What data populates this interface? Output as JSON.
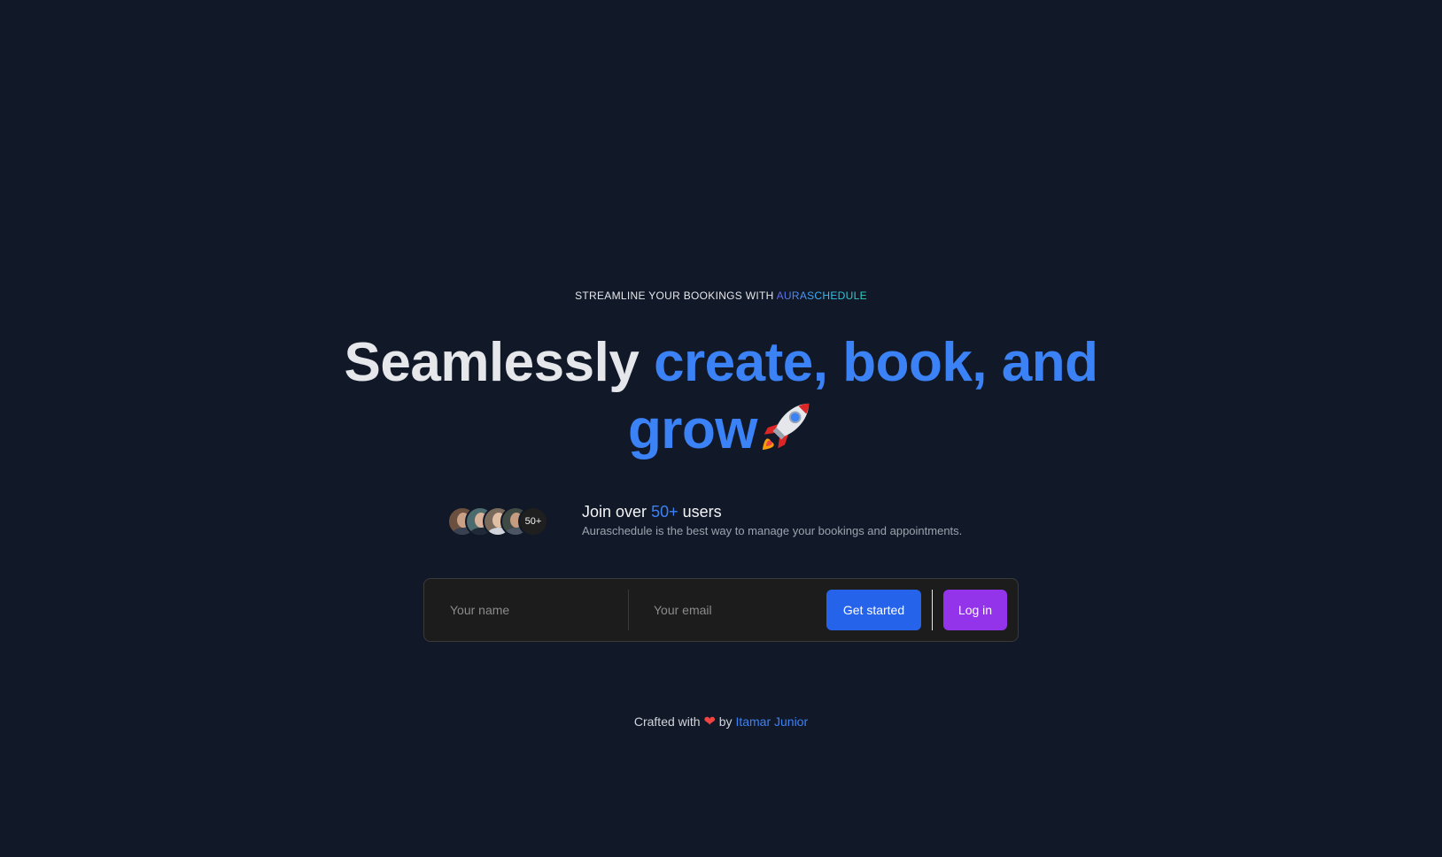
{
  "hero": {
    "eyebrow_prefix": "STREAMLINE YOUR BOOKINGS WITH",
    "eyebrow_brand": "AURASCHEDULE",
    "headline_plain": "Seamlessly",
    "headline_accent_line1": "create, book, and",
    "headline_accent_line2": "grow",
    "headline_icon": "rocket-icon"
  },
  "social_proof": {
    "avatar_count_badge": "50+",
    "title_prefix": "Join over",
    "title_accent": "50+",
    "title_suffix": "users",
    "subtitle": "Auraschedule is the best way to manage your bookings and appointments."
  },
  "signup_form": {
    "name_placeholder": "Your name",
    "email_placeholder": "Your email",
    "get_started_label": "Get started",
    "login_label": "Log in"
  },
  "footer": {
    "prefix": "Crafted with",
    "heart": "❤",
    "by": "by",
    "author_link": "Itamar Junior"
  },
  "colors": {
    "background": "#111827",
    "accent_blue": "#3b82f6",
    "primary_button": "#2563eb",
    "secondary_button": "#9333ea"
  }
}
